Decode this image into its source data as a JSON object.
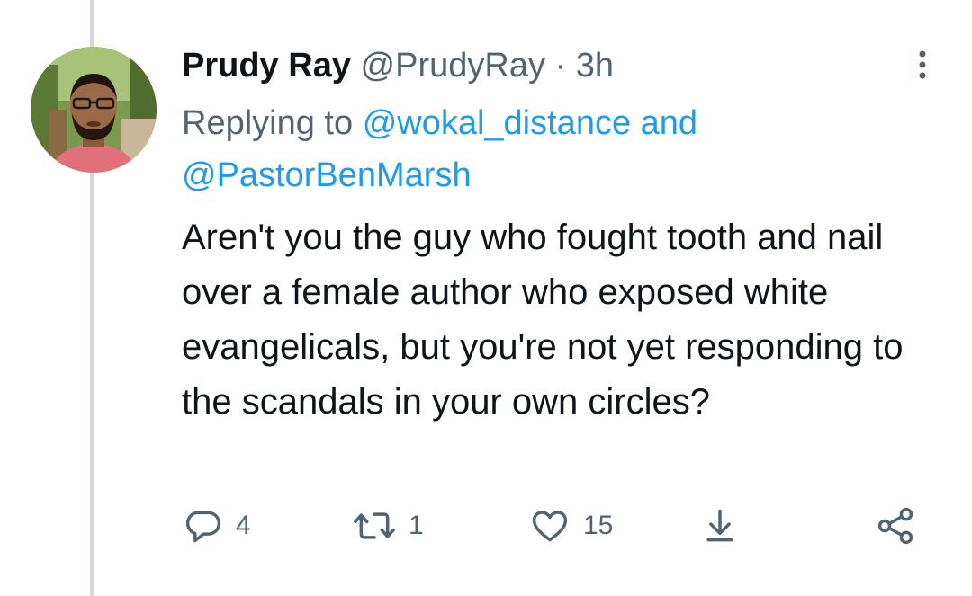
{
  "tweet": {
    "display_name": "Prudy Ray",
    "handle": "@PrudyRay",
    "separator": "·",
    "time": "3h",
    "replying_prefix": "Replying to",
    "reply_mention_1": "@wokal_distance",
    "reply_and": "and",
    "reply_mention_2": "@PastorBenMarsh",
    "text": "Aren't you the guy who fought tooth and nail over a female author who exposed white evangelicals, but you're not yet responding to the scandals in your own circles?"
  },
  "actions": {
    "reply_count": "4",
    "retweet_count": "1",
    "like_count": "15"
  },
  "icons": {
    "reply": "reply-icon",
    "retweet": "retweet-icon",
    "like": "heart-icon",
    "download": "download-icon",
    "share": "share-icon",
    "more": "more-vertical-icon"
  },
  "colors": {
    "text_primary": "#0f1419",
    "text_secondary": "#536471",
    "mention": "#1d9bf0",
    "thread_line": "#cfd9de"
  }
}
